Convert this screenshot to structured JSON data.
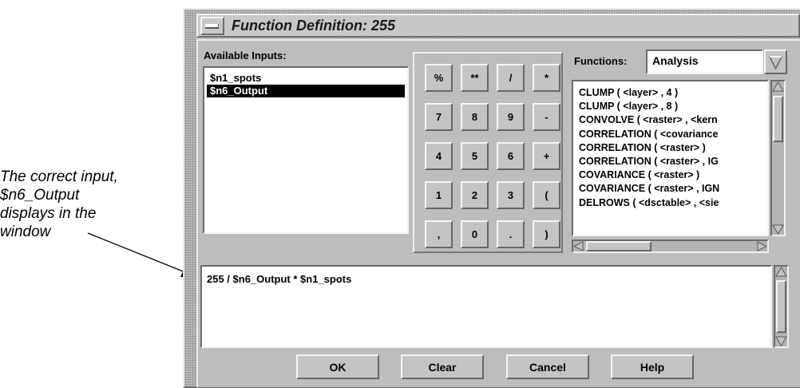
{
  "annotation": {
    "lines": [
      "The correct input,",
      "$n6_Output",
      "displays in the",
      "window"
    ]
  },
  "window": {
    "title": "Function Definition: 255"
  },
  "inputs": {
    "label": "Available Inputs:",
    "items": [
      "$n1_spots",
      "$n6_Output"
    ],
    "selected_index": 1
  },
  "keypad": {
    "rows": [
      [
        "%",
        "**",
        "/",
        "*"
      ],
      [
        "7",
        "8",
        "9",
        "-"
      ],
      [
        "4",
        "5",
        "6",
        "+"
      ],
      [
        "1",
        "2",
        "3",
        "("
      ],
      [
        ",",
        "0",
        ".",
        ")"
      ]
    ]
  },
  "functions": {
    "label": "Functions:",
    "category": "Analysis",
    "items": [
      "CLUMP ( <layer> , 4 )",
      "CLUMP ( <layer> , 8 )",
      "CONVOLVE ( <raster> , <kern",
      "CORRELATION ( <covariance",
      "CORRELATION ( <raster> )",
      "CORRELATION ( <raster> , IG",
      "COVARIANCE ( <raster> )",
      "COVARIANCE ( <raster> , IGN",
      "DELROWS ( <dsctable> , <sie"
    ]
  },
  "expression": {
    "value": "255 / $n6_Output * $n1_spots"
  },
  "buttons": {
    "ok": "OK",
    "clear": "Clear",
    "cancel": "Cancel",
    "help": "Help"
  },
  "colors": {
    "window_bg": "#bdbdbd",
    "selection_bg": "#000000",
    "selection_fg": "#ffffff"
  }
}
